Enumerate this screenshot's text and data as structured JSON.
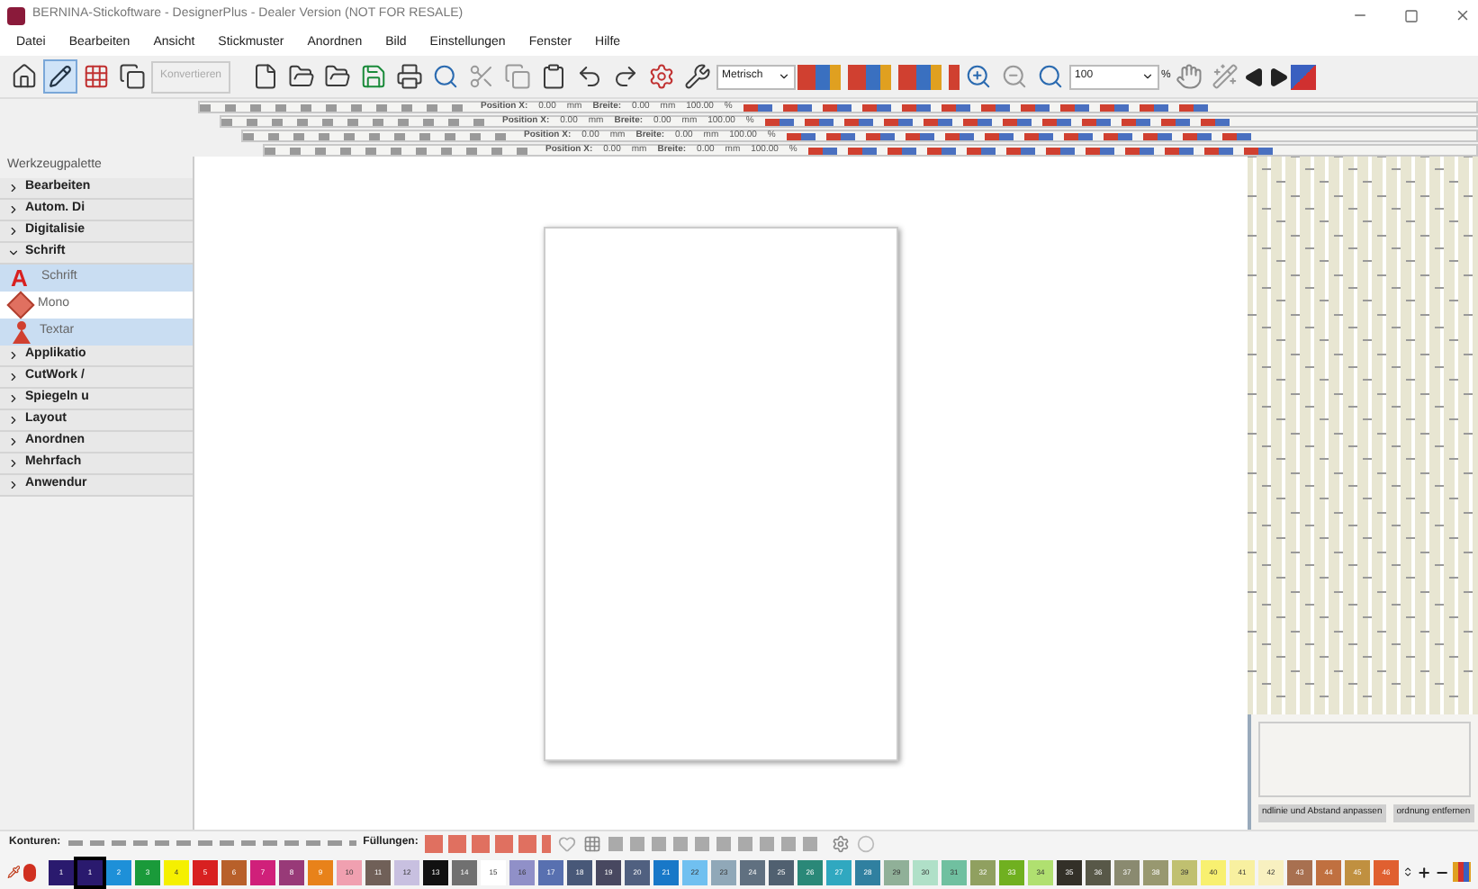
{
  "window": {
    "title": "BERNINA-Stickoftware - DesignerPlus - Dealer Version (NOT FOR RESALE)"
  },
  "menu": [
    "Datei",
    "Bearbeiten",
    "Ansicht",
    "Stickmuster",
    "Anordnen",
    "Bild",
    "Einstellungen",
    "Fenster",
    "Hilfe"
  ],
  "toolbar": {
    "convert_button": {
      "label": "Konvertieren",
      "disabled": true
    },
    "units": "Metrisch",
    "zoom": "100",
    "zoom_unit": "%"
  },
  "property_bars": [
    {
      "position_label": "Position X:",
      "position_value": "0.00",
      "position_unit": "mm",
      "width_label": "Breite:",
      "width_value": "0.00",
      "width_unit": "mm",
      "scale_value": "100.00",
      "scale_unit": "%"
    },
    {
      "position_label": "Position X:",
      "position_value": "0.00",
      "position_unit": "mm",
      "width_label": "Breite:",
      "width_value": "0.00",
      "width_unit": "mm",
      "scale_value": "100.00",
      "scale_unit": "%"
    },
    {
      "position_label": "Position X:",
      "position_value": "0.00",
      "position_unit": "mm",
      "width_label": "Breite:",
      "width_value": "0.00",
      "width_unit": "mm",
      "scale_value": "100.00",
      "scale_unit": "%"
    },
    {
      "position_label": "Position X:",
      "position_value": "0.00",
      "position_unit": "mm",
      "width_label": "Breite:",
      "width_value": "0.00",
      "width_unit": "mm",
      "scale_value": "100.00",
      "scale_unit": "%"
    }
  ],
  "sidebar": {
    "title": "Werkzeugpalette",
    "sections": [
      {
        "label": "Bearbeiten",
        "expanded": false
      },
      {
        "label": "Autom. Di",
        "expanded": false
      },
      {
        "label": "Digitalisie",
        "expanded": false
      },
      {
        "label": "Schrift",
        "expanded": true,
        "items": [
          {
            "label": "Schrift",
            "selected": true,
            "kind": "letter",
            "glyph": "A"
          },
          {
            "label": "Mono",
            "selected": false,
            "kind": "monogram"
          },
          {
            "label": "Textar",
            "selected": true,
            "kind": "figure"
          }
        ]
      },
      {
        "label": "Applikatio",
        "expanded": false
      },
      {
        "label": "CutWork /",
        "expanded": false
      },
      {
        "label": "Spiegeln u",
        "expanded": false
      },
      {
        "label": "Layout",
        "expanded": false
      },
      {
        "label": "Anordnen",
        "expanded": false
      },
      {
        "label": "Mehrfach",
        "expanded": false
      },
      {
        "label": "Anwendur",
        "expanded": false
      }
    ]
  },
  "side_panel": {
    "buttons": [
      "ndlinie und Abstand anpassen",
      "ordnung entfernen"
    ]
  },
  "bottom": {
    "outlines_label": "Konturen:",
    "fills_label": "Füllungen:"
  },
  "palette": [
    {
      "number": "1",
      "color": "#2a1a6e",
      "selected": false
    },
    {
      "number": "1",
      "color": "#2a1a6e",
      "selected": true
    },
    {
      "number": "2",
      "color": "#1e90d8",
      "selected": false
    },
    {
      "number": "3",
      "color": "#1a9a3a",
      "selected": false
    },
    {
      "number": "4",
      "color": "#f5f000",
      "selected": false
    },
    {
      "number": "5",
      "color": "#d82020",
      "selected": false
    },
    {
      "number": "6",
      "color": "#b8602a",
      "selected": false
    },
    {
      "number": "7",
      "color": "#d0207a",
      "selected": false
    },
    {
      "number": "8",
      "color": "#983a78",
      "selected": false
    },
    {
      "number": "9",
      "color": "#e8821a",
      "selected": false
    },
    {
      "number": "10",
      "color": "#f0a0b0",
      "selected": false
    },
    {
      "number": "11",
      "color": "#706058",
      "selected": false
    },
    {
      "number": "12",
      "color": "#c8c0e0",
      "selected": false
    },
    {
      "number": "13",
      "color": "#111111",
      "selected": false
    },
    {
      "number": "14",
      "color": "#707070",
      "selected": false
    },
    {
      "number": "15",
      "color": "#ffffff",
      "selected": false
    },
    {
      "number": "16",
      "color": "#9090c8",
      "selected": false
    },
    {
      "number": "17",
      "color": "#5870b0",
      "selected": false
    },
    {
      "number": "18",
      "color": "#485878",
      "selected": false
    },
    {
      "number": "19",
      "color": "#484860",
      "selected": false
    },
    {
      "number": "20",
      "color": "#506080",
      "selected": false
    },
    {
      "number": "21",
      "color": "#1878c8",
      "selected": false
    },
    {
      "number": "22",
      "color": "#70c0f0",
      "selected": false
    },
    {
      "number": "23",
      "color": "#90a8b8",
      "selected": false
    },
    {
      "number": "24",
      "color": "#607080",
      "selected": false
    },
    {
      "number": "25",
      "color": "#506070",
      "selected": false
    },
    {
      "number": "26",
      "color": "#2a8878",
      "selected": false
    },
    {
      "number": "27",
      "color": "#30a8c0",
      "selected": false
    },
    {
      "number": "28",
      "color": "#3080a0",
      "selected": false
    },
    {
      "number": "29",
      "color": "#90b098",
      "selected": false
    },
    {
      "number": "30",
      "color": "#b0e0c8",
      "selected": false
    },
    {
      "number": "31",
      "color": "#70c0a0",
      "selected": false
    },
    {
      "number": "32",
      "color": "#90a060",
      "selected": false
    },
    {
      "number": "33",
      "color": "#70b020",
      "selected": false
    },
    {
      "number": "34",
      "color": "#b0e070",
      "selected": false
    },
    {
      "number": "35",
      "color": "#333028",
      "selected": false
    },
    {
      "number": "36",
      "color": "#585848",
      "selected": false
    },
    {
      "number": "37",
      "color": "#8a8a70",
      "selected": false
    },
    {
      "number": "38",
      "color": "#989870",
      "selected": false
    },
    {
      "number": "39",
      "color": "#c0c070",
      "selected": false
    },
    {
      "number": "40",
      "color": "#f8f070",
      "selected": false
    },
    {
      "number": "41",
      "color": "#f8f0a0",
      "selected": false
    },
    {
      "number": "42",
      "color": "#f8f0c0",
      "selected": false
    },
    {
      "number": "43",
      "color": "#a87050",
      "selected": false
    },
    {
      "number": "44",
      "color": "#c07040",
      "selected": false
    },
    {
      "number": "45",
      "color": "#c09040",
      "selected": false
    },
    {
      "number": "46",
      "color": "#e06030",
      "selected": false
    }
  ]
}
